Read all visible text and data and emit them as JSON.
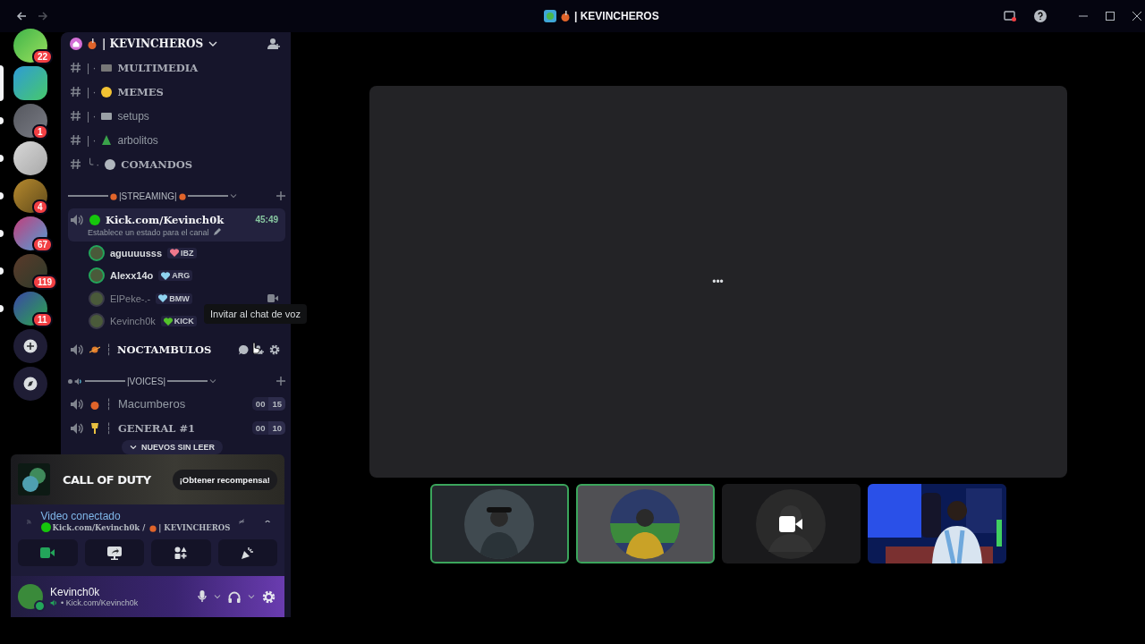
{
  "titlebar": {
    "title": "| KEVINCHEROS"
  },
  "servers": [
    {
      "badge": "22",
      "selected": false,
      "unread": false
    },
    {
      "selected": true,
      "unread": true
    },
    {
      "badge": "1",
      "selected": false,
      "unread": true
    },
    {
      "selected": false,
      "unread": true
    },
    {
      "badge": "4",
      "selected": false,
      "unread": true
    },
    {
      "badge": "67",
      "selected": false,
      "unread": true
    },
    {
      "badge": "119",
      "selected": false,
      "unread": true
    },
    {
      "badge": "11",
      "selected": false,
      "unread": true
    }
  ],
  "server_header": {
    "name": "| KEVINCHEROS"
  },
  "text_channels": [
    {
      "prefix": "| ·",
      "name": "MULTIMEDIA",
      "kind": "fancy"
    },
    {
      "prefix": "| ·",
      "name": "MEMES",
      "kind": "fancy"
    },
    {
      "prefix": "| ·",
      "name": "setups",
      "kind": "plain"
    },
    {
      "prefix": "| ·",
      "name": "arbolitos",
      "kind": "plain"
    },
    {
      "prefix": "╰ ·",
      "name": "COMANDOS",
      "kind": "fancy"
    }
  ],
  "streaming_category": {
    "label": "|STREAMING|"
  },
  "live_channel": {
    "name": "Kick.com/Kevinch0k",
    "timer": "45:49",
    "status": "Establece un estado para el canal",
    "members": [
      {
        "name": "aguuuusss",
        "tag": "IBZ",
        "color": "#f0788c",
        "speaking": true,
        "video": false
      },
      {
        "name": "Alexx14o",
        "tag": "ARG",
        "color": "#8fd3f0",
        "speaking": true,
        "video": false
      },
      {
        "name": "ElPeke-.-",
        "tag": "BMW",
        "color": "#8fd3f0",
        "speaking": false,
        "video": true
      },
      {
        "name": "Kevinch0k",
        "tag": "KICK",
        "color": "#53c22b",
        "speaking": false,
        "video": false
      }
    ]
  },
  "noctambulos": {
    "prefix": "┆",
    "name": "NOCTAMBULOS",
    "tooltip": "Invitar al chat de voz"
  },
  "voices_category": {
    "label": "|VOICES|"
  },
  "voice_channels": [
    {
      "prefix": "┆",
      "name": "Macumberos",
      "count": "00",
      "limit": "15"
    },
    {
      "prefix": "┆",
      "name": "GENERAL #1",
      "count": "00",
      "limit": "10"
    }
  ],
  "unread_pill": "NUEVOS SIN LEER",
  "promo": {
    "logo": "CALL OF DUTY",
    "button": "¡Obtener recompensa!"
  },
  "voice_panel": {
    "status": "Video conectado",
    "channel": "Kick.com/Kevinch0k / ",
    "server": "| KEVINCHEROS",
    "camera_on": true
  },
  "user": {
    "name": "Kevinch0k",
    "status": "• Kick.com/Kevinch0k"
  },
  "stage": {
    "loader": "•••"
  },
  "tiles": [
    {
      "kind": "avatar",
      "speaking": true
    },
    {
      "kind": "avatar",
      "speaking": true
    },
    {
      "kind": "camera_off",
      "speaking": false
    },
    {
      "kind": "video",
      "speaking": false
    }
  ]
}
